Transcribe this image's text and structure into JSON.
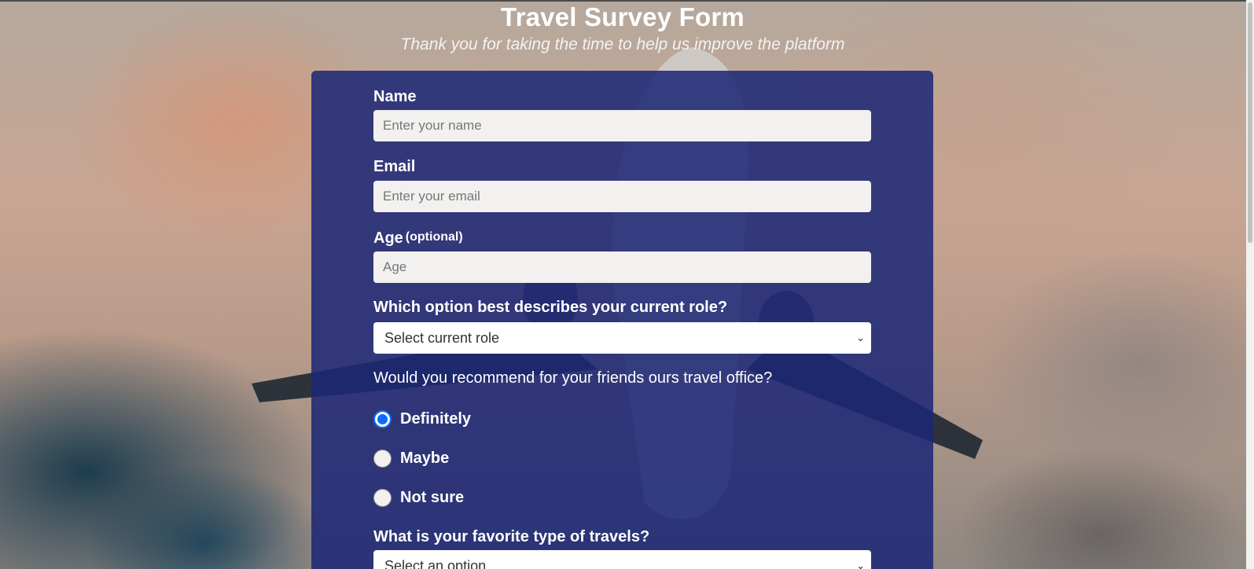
{
  "header": {
    "title": "Travel Survey Form",
    "subtitle": "Thank you for taking the time to help us improve the platform"
  },
  "form": {
    "name": {
      "label": "Name",
      "placeholder": "Enter your name",
      "value": ""
    },
    "email": {
      "label": "Email",
      "placeholder": "Enter your email",
      "value": ""
    },
    "age": {
      "label": "Age",
      "clarification": "(optional)",
      "placeholder": "Age",
      "value": ""
    },
    "role": {
      "question": "Which option best describes your current role?",
      "selected": "Select current role",
      "chevron": "chevron-down-icon"
    },
    "recommend": {
      "question": "Would you recommend for your friends ours travel office?",
      "options": [
        {
          "label": "Definitely",
          "checked": true
        },
        {
          "label": "Maybe",
          "checked": false
        },
        {
          "label": "Not sure",
          "checked": false
        }
      ]
    },
    "travel_type": {
      "question": "What is your favorite type of travels?",
      "selected": "Select an option",
      "chevron": "chevron-down-icon"
    }
  },
  "colors": {
    "card": "#1b2776",
    "accent": "#0a6cff",
    "input_bg": "#f2f1ef",
    "text": "#ffffff"
  }
}
